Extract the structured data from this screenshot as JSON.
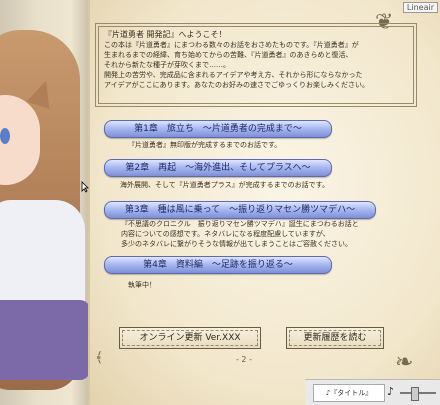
{
  "window": {
    "badge": "Lineair"
  },
  "intro": {
    "title": "『片道勇者 開発記』へようこそ！",
    "lines": [
      "この本は『片道勇者』にまつわる数々のお話をおさめたものです。『片道勇者』が",
      "生まれるまでの経緯、育ち始めてからの苦難、『片道勇者』のあきらめと復活、",
      "それから新たな種子が芽吹くまで……。",
      "開発上の苦労や、完成品に含まれるアイデアや考え方、それから形にならなかった",
      "アイデアがここにあります。あなたのお好みの速さでごゆっくりお楽しみください。"
    ]
  },
  "chapters": [
    {
      "label": "第1章　旅立ち　～片道勇者の完成まで～",
      "desc": [
        "『片道勇者』無印版が完成するまでのお話です。"
      ]
    },
    {
      "label": "第2章　再起　～海外進出、そしてプラスへ～",
      "desc": [
        "海外展開、そして『片道勇者プラス』が完成するまでのお話です。"
      ]
    },
    {
      "label": "第3章　種は風に乗って　～振り返りマセン勝ツマデハ～",
      "desc": [
        "『不思議のクロニクル　振り返りマセン勝ツマデハ』誕生にまつわるお話と",
        "内容についての感想です。ネタバレになる程度配慮していますが、",
        "多少のネタバレに繋がりそうな情報が出てしまうことはご容赦ください。"
      ]
    },
    {
      "label": "第4章　資料編　～足跡を振り返る～",
      "desc": [
        "執筆中！"
      ]
    }
  ],
  "buttons": {
    "online_update": "オンライン更新 Ver.XXX",
    "history": "更新履歴を読む"
  },
  "page_number": "- 2 -",
  "audio": {
    "title": "♪『タイトル』",
    "volume": 0.35
  }
}
